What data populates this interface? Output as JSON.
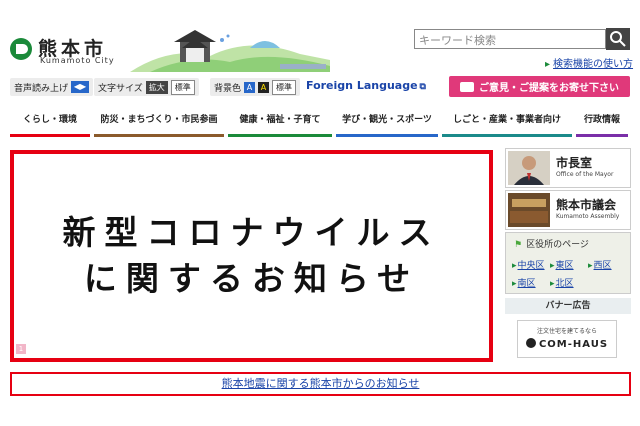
{
  "header": {
    "logo_jp": "熊本市",
    "logo_en": "Kumamoto City",
    "search_placeholder": "キーワード検索",
    "search_link": "検索機能の使い方"
  },
  "toolbar": {
    "speech_label": "音声読み上げ",
    "font_size_label": "文字サイズ",
    "font_enlarge": "拡大",
    "font_standard": "標準",
    "bg_color_label": "背景色",
    "bg_a1": "A",
    "bg_a2": "A",
    "bg_standard": "標準",
    "foreign_language": "Foreign Language",
    "opinion": "ご意見・ご提案をお寄せ下さい"
  },
  "nav": {
    "items": [
      {
        "label": "くらし・環境",
        "color": "#e60012"
      },
      {
        "label": "防災・まちづくり・市民参画",
        "color": "#8b5a2b"
      },
      {
        "label": "健康・福祉・子育て",
        "color": "#1b8a3a"
      },
      {
        "label": "学び・観光・スポーツ",
        "color": "#2767c9"
      },
      {
        "label": "しごと・産業・事業者向け",
        "color": "#1b8a8a"
      },
      {
        "label": "行政情報",
        "color": "#7a2fa8"
      }
    ]
  },
  "main_banner": {
    "line1": "新型コロナウイルス",
    "line2": "に関するお知らせ",
    "page_number": "1"
  },
  "side": {
    "mayor_title": "市長室",
    "mayor_sub": "Office of the Mayor",
    "assembly_title": "熊本市議会",
    "assembly_sub": "Kumamoto Assembly",
    "ward_title": "区役所のページ",
    "wards": [
      "中央区",
      "東区",
      "西区",
      "南区",
      "北区"
    ],
    "banner_title": "バナー広告",
    "ad_sub": "注文住宅を建てるなら",
    "ad_main": "COM-HAUS"
  },
  "footer": {
    "quake_link": "熊本地震に関する熊本市からのお知らせ"
  },
  "colors": {
    "accent_red": "#e60012",
    "brand_green": "#1b8a3a",
    "link_blue": "#1a44a8",
    "opinion_pink": "#e0397a"
  }
}
